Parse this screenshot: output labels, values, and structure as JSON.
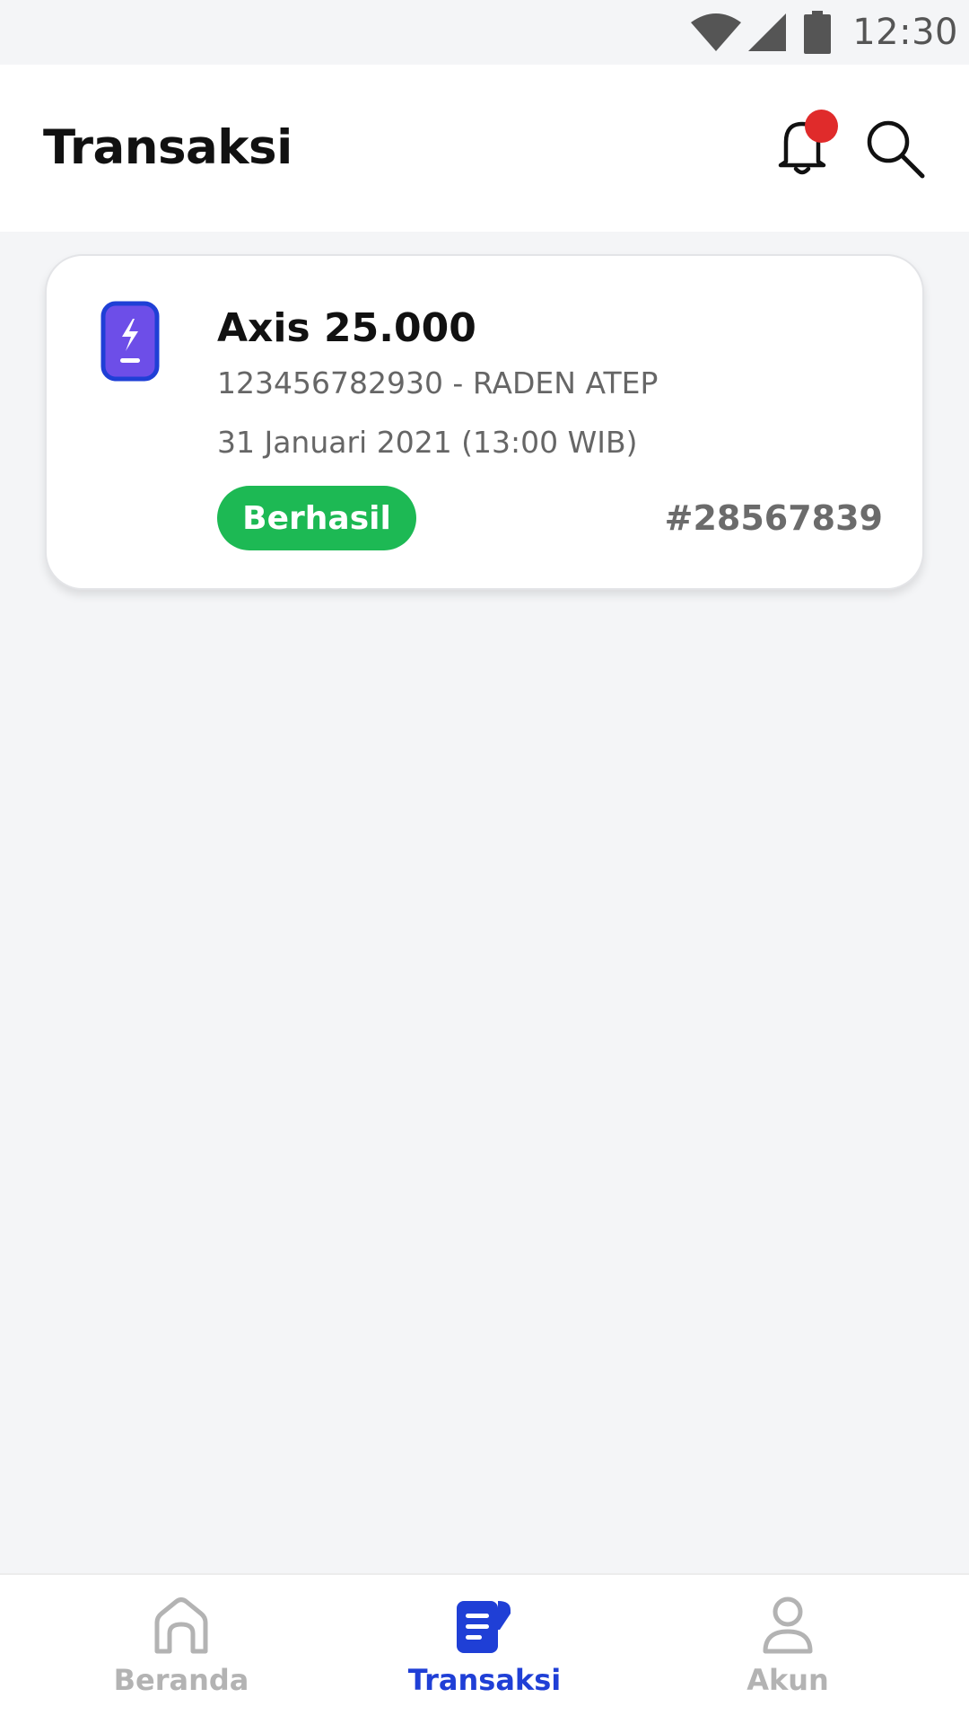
{
  "status_bar": {
    "time": "12:30",
    "icons": [
      "wifi-icon",
      "signal-icon",
      "battery-icon"
    ]
  },
  "header": {
    "title": "Transaksi",
    "icons": [
      "bell-icon",
      "search-icon"
    ],
    "notification_dot_color": "#e02b2b"
  },
  "transactions": [
    {
      "icon": "phone-credit-icon",
      "title": "Axis 25.000",
      "account": "123456782930 - RADEN ATEP",
      "date": "31 Januari 2021 (13:00 WIB)",
      "status": "Berhasil",
      "status_color": "#1db954",
      "id": "#28567839"
    }
  ],
  "bottom_nav": {
    "items": [
      {
        "label": "Beranda",
        "icon": "home-icon",
        "active": false
      },
      {
        "label": "Transaksi",
        "icon": "receipt-icon",
        "active": true
      },
      {
        "label": "Akun",
        "icon": "user-icon",
        "active": false
      }
    ],
    "active_color": "#1f3fd6",
    "inactive_color": "#b3b3b3"
  }
}
